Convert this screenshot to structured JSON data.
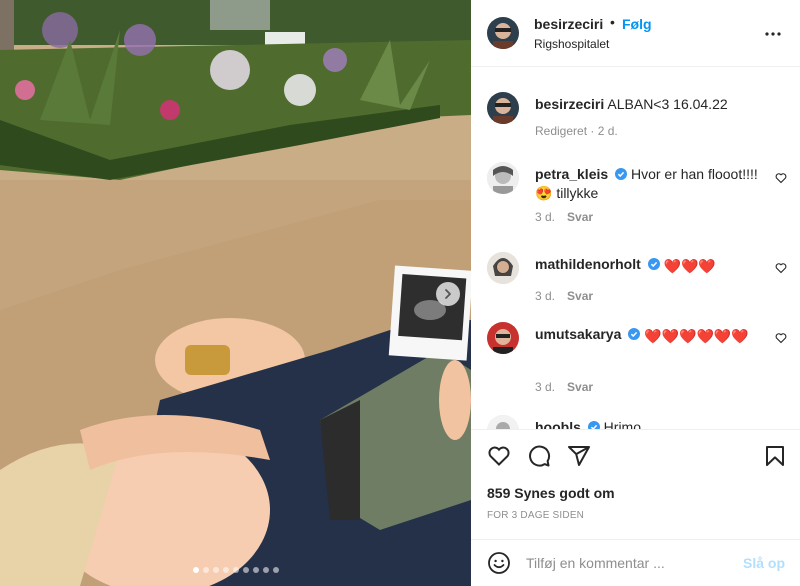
{
  "post": {
    "username": "besirzeciri",
    "separator": "•",
    "follow_label": "Følg",
    "location": "Rigshospitalet",
    "caption": "ALBAN<3 16.04.22",
    "caption_meta": "Redigeret · 2 d.",
    "likes": "859 Synes godt om",
    "posted_ago": "FOR 3 DAGE SIDEN",
    "carousel": {
      "slides": 9,
      "active_index": 0
    }
  },
  "comments": [
    {
      "username": "petra_kleis",
      "verified": true,
      "text": "Hvor er han flooot!!!! 😍 tillykke",
      "time": "3 d.",
      "reply": "Svar"
    },
    {
      "username": "mathildenorholt",
      "verified": true,
      "text": "❤️❤️❤️",
      "time": "3 d.",
      "reply": "Svar"
    },
    {
      "username": "umutsakarya",
      "verified": true,
      "text": "❤️❤️❤️❤️❤️❤️",
      "time": "3 d.",
      "reply": "Svar"
    },
    {
      "username": "hoobls",
      "verified": true,
      "text": "Hrimo",
      "time": "",
      "reply": ""
    }
  ],
  "add_comment": {
    "placeholder": "Tilføj en kommentar ...",
    "post_label": "Slå op"
  },
  "icons": {
    "more": "more-options-icon",
    "like": "heart-icon",
    "comment": "comment-icon",
    "share": "share-icon",
    "save": "bookmark-icon",
    "emoji": "emoji-icon",
    "next": "chevron-right-icon"
  },
  "colors": {
    "link": "#0095f6",
    "verified": "#3897f0",
    "muted": "#8e8e8e",
    "post_disabled": "#b2dffc"
  }
}
